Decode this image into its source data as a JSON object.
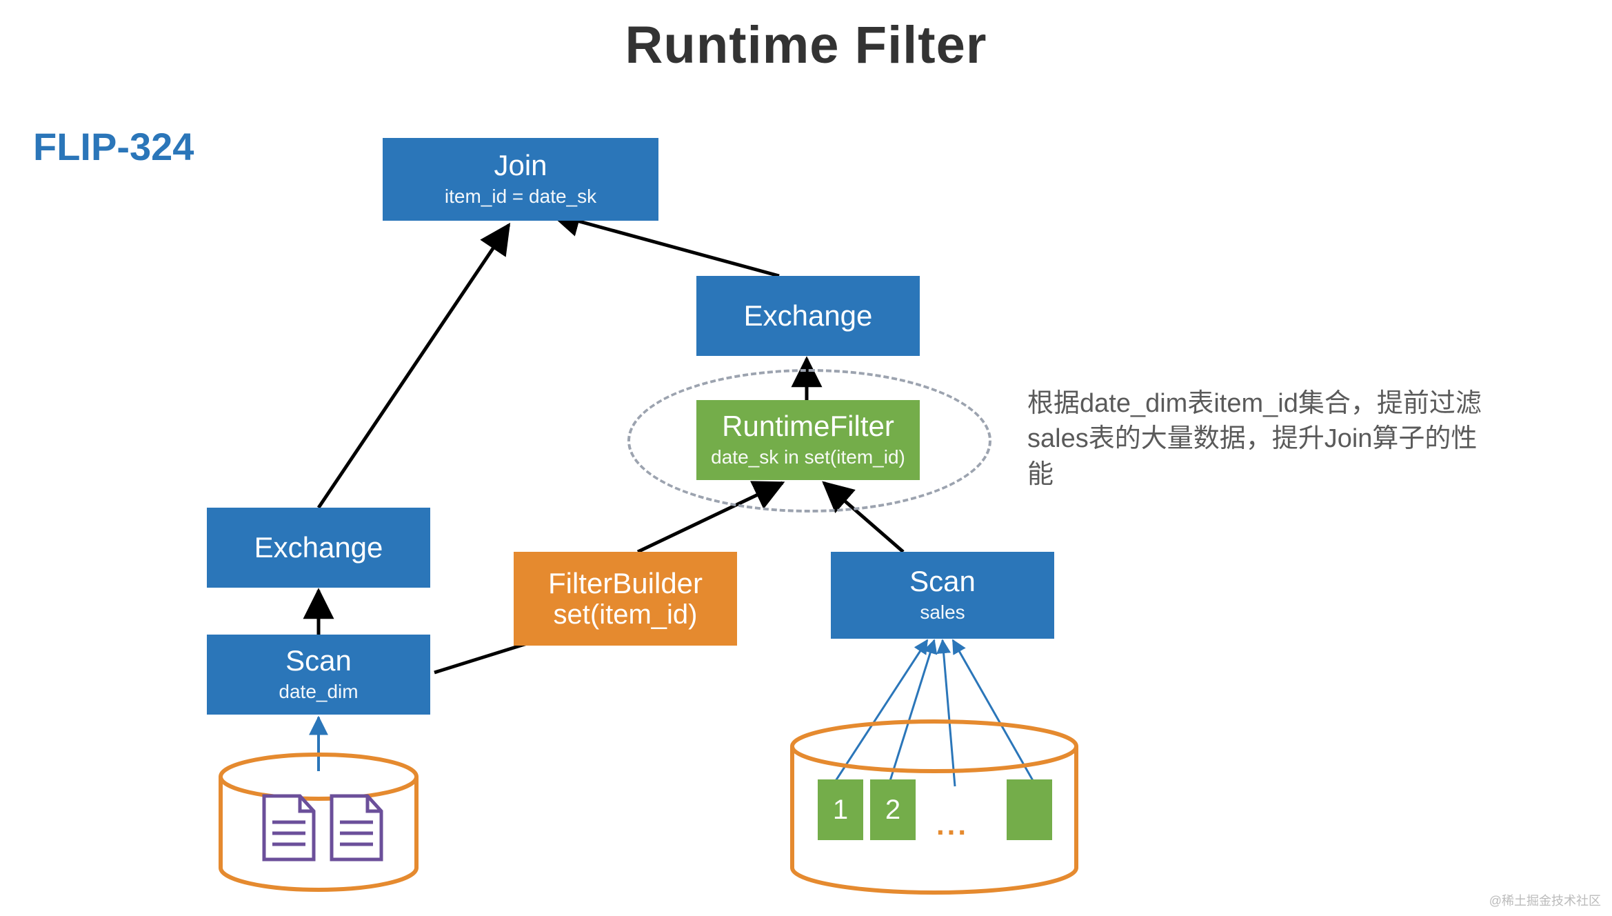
{
  "title": "Runtime Filter",
  "flip_label": "FLIP-324",
  "nodes": {
    "join": {
      "line1": "Join",
      "line2": "item_id = date_sk"
    },
    "exchange_r": {
      "line1": "Exchange",
      "line2": ""
    },
    "runtime_filter": {
      "line1": "RuntimeFilter",
      "line2": "date_sk in set(item_id)"
    },
    "filter_builder": {
      "line1": "FilterBuilder",
      "line2": "set(item_id)"
    },
    "scan_sales": {
      "line1": "Scan",
      "line2": "sales"
    },
    "exchange_l": {
      "line1": "Exchange",
      "line2": ""
    },
    "scan_date_dim": {
      "line1": "Scan",
      "line2": "date_dim"
    }
  },
  "annotation": "根据date_dim表item_id集合，提前过滤sales表的大量数据，提升Join算子的性能",
  "partitions": {
    "p1": "1",
    "p2": "2",
    "ellipsis": "..."
  },
  "watermark": "@稀土掘金技术社区",
  "colors": {
    "blue": "#2b76b9",
    "green": "#74ad4a",
    "orange": "#e58a2f",
    "dbStroke": "#e58a2f",
    "arrowBlack": "#000000",
    "arrowBlue": "#2b76b9",
    "docStroke": "#6b4f9a",
    "dashStroke": "#9ca3af"
  }
}
